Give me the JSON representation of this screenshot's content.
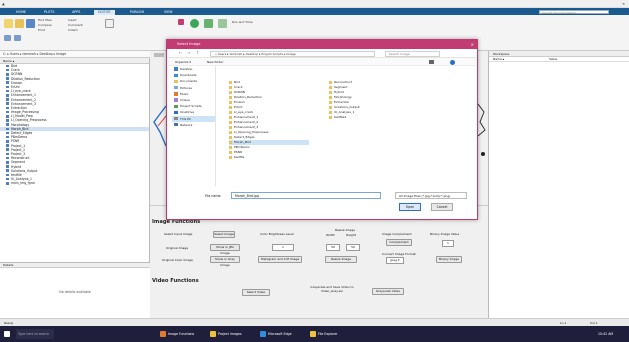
{
  "app": {
    "title_tabs": [
      "HOME",
      "PLOTS",
      "APPS",
      "EDITOR",
      "PUBLISH",
      "VIEW"
    ],
    "active_tab": "EDITOR",
    "search_placeholder": "Search Documentation"
  },
  "toolbar": {
    "labels": [
      "New",
      "Open",
      "Save",
      "Find Files",
      "Compare",
      "Print",
      "Go To",
      "Find",
      "Insert",
      "Comment",
      "Indent",
      "Breakpoints",
      "Run",
      "Run and Advance",
      "Run Section",
      "Advance",
      "Run and Time"
    ]
  },
  "current_folder": {
    "path": "C: ▸ Users ▸ tammah ▸ Desktop ▸ Image",
    "header": "Name ▴",
    "files": [
      "Bird",
      "Crack",
      "DCRNN",
      "Dilation_Reduction",
      "Erosion",
      "ErUnt",
      "LI_eye_crack",
      "Enhancement_1",
      "Enhancement_2",
      "Enhancement_3",
      "Extraction",
      "Image_Processing",
      "LI_Model_Prep",
      "LI_Opening_Preprocess",
      "Morphology",
      "Morph_Bird",
      "Detect_Edges",
      "PBmDemo",
      "PSNR",
      "Project_1",
      "Project_2",
      "Project_3",
      "Reconstruct",
      "Segment",
      "Hybrid",
      "Solutions_Output",
      "testfile",
      "UI_Analysis_1",
      "main_img_fgnd"
    ],
    "selected_file": "Morph_Bird",
    "details_header": "Details",
    "details_text": "No details available"
  },
  "workspace": {
    "header": "Workspace",
    "col_name": "Name ▴",
    "col_value": "Value"
  },
  "dialog": {
    "title": "Select Image",
    "address": "« Users ▸ tammah ▸ Desktop ▸ Project Scripts ▸ Image",
    "search": "Search Image",
    "organize": "Organize ▾",
    "new_folder": "New folder",
    "sidebar": [
      "Desktop",
      "Downloads",
      "Documents",
      "Pictures",
      "Music",
      "Videos",
      "Project Scripts",
      "OneDrive",
      "This PC",
      "Network"
    ],
    "sidebar_selected": "This PC",
    "files_col1": [
      "Bird",
      "Crack",
      "DCRNN",
      "Dilation_Reduction",
      "Erosion",
      "ErUnt",
      "LI_eye_crack",
      "Enhancement_1",
      "Enhancement_2",
      "Enhancement_3",
      "LI_Opening_Preprocess",
      "Detect_Edges",
      "Morph_Bird",
      "PBmDemo",
      "PSNR",
      "testfile"
    ],
    "files_col2": [
      "Reconstruct",
      "Segment",
      "Hybrid",
      "Morphology",
      "Extraction",
      "Solutions_Output",
      "UI_Analysis_1",
      "testfile2"
    ],
    "selected_file": "Morph_Bird",
    "filename_label": "File name:",
    "filename_value": "Morph_Bird.jpg",
    "filetype_value": "All Image Files (*.jpg;*.bmp;*.png)",
    "open_label": "Open",
    "cancel_label": "Cancel"
  },
  "figure": {
    "image_functions_title": "Image Functions",
    "video_functions_title": "Video Functions",
    "row1": [
      "Select Input Image",
      "Select Image",
      "Color Brightness Level",
      "Resize Image",
      "Image Complement",
      "Binary Image Value"
    ],
    "row1_values": [
      "Width",
      "Height"
    ],
    "row2": [
      "Original Image",
      "Show in JPG Image",
      "1",
      "50",
      "50",
      "Complement",
      "1"
    ],
    "row3": [
      "Original Color Image",
      "Show in Gray Image",
      "Histogram and Cdf Image",
      "Resize Image",
      "Convert Image Format",
      "Binary Image"
    ],
    "row3_select": "Jpeg",
    "video_buttons": [
      "Select Video",
      "Grayscale and Save Video to Video_Gray.avi",
      "Grayscale Video"
    ]
  },
  "status": {
    "left": "Ready",
    "right": [
      "Ln 1",
      "Col 1"
    ]
  },
  "taskbar": {
    "items": [
      "Type here to search",
      "Image Functions",
      "Project Images",
      "Microsoft Edge",
      "File Explorer"
    ],
    "clock": "10:42 AM"
  }
}
